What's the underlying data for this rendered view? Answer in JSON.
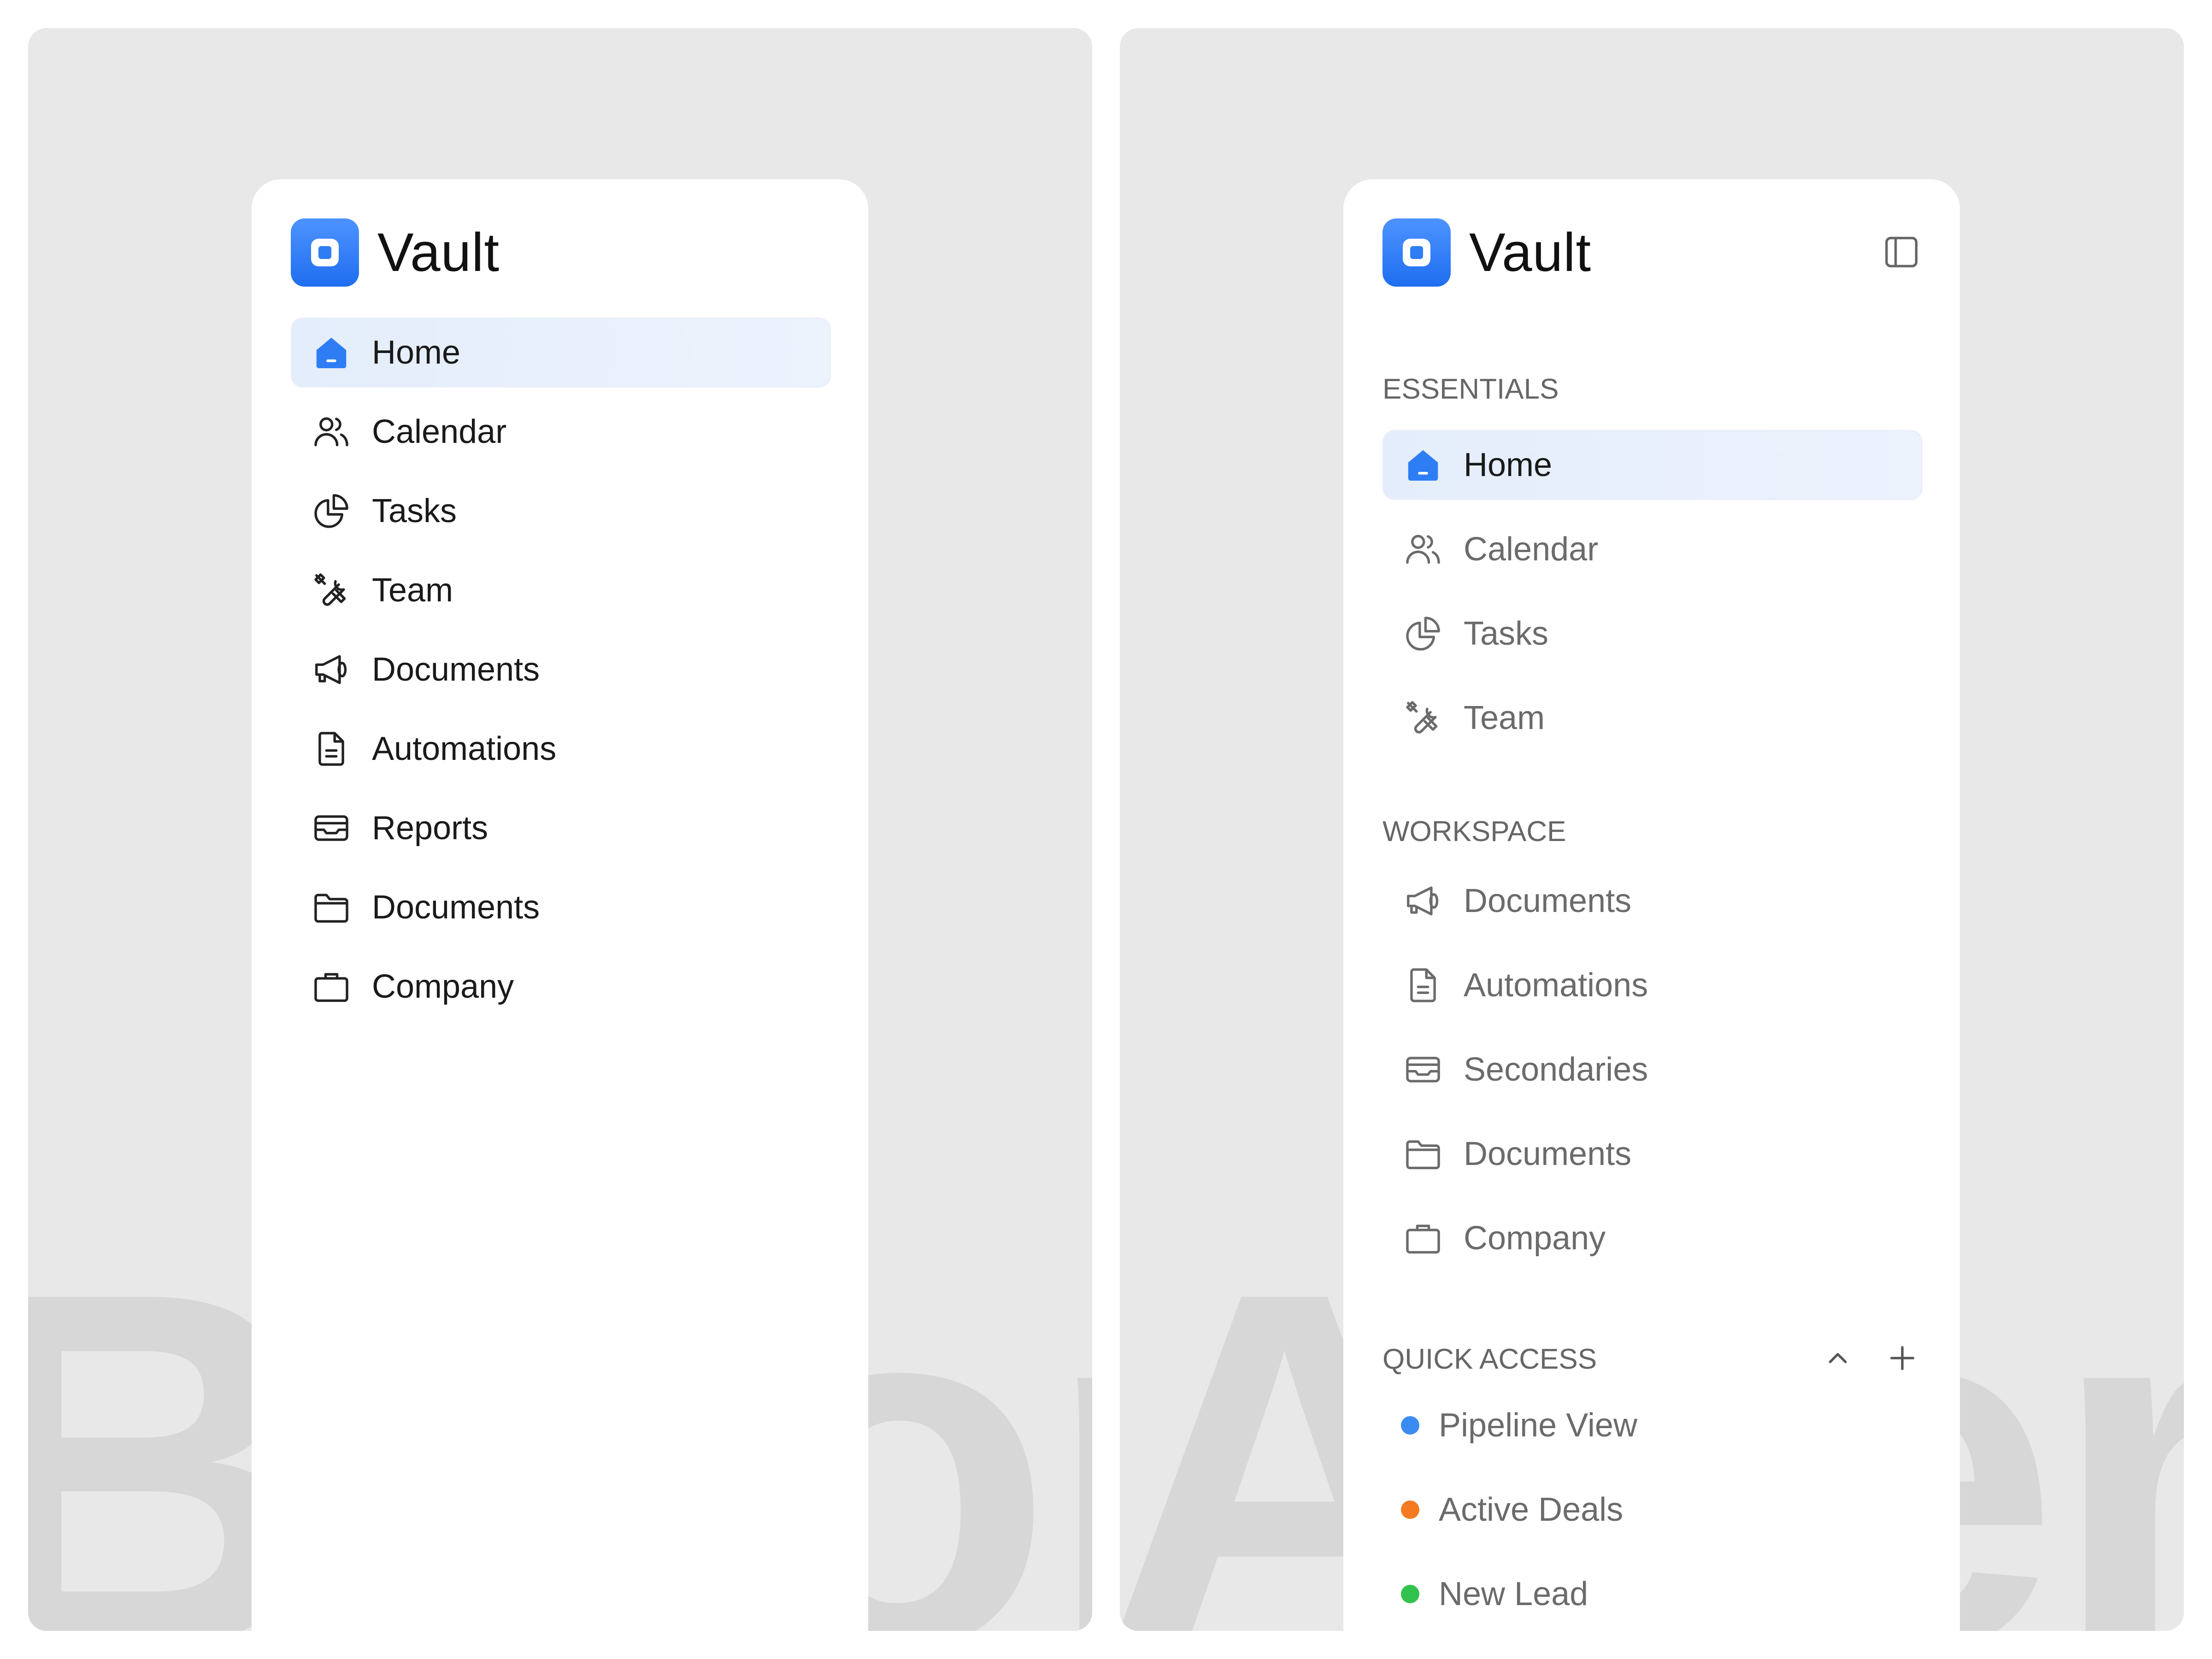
{
  "background_words": {
    "left": "Before",
    "right": "After"
  },
  "left_sidebar": {
    "brand": "Vault",
    "items": [
      {
        "label": "Home",
        "icon": "home-icon",
        "active": true
      },
      {
        "label": "Calendar",
        "icon": "users-icon"
      },
      {
        "label": "Tasks",
        "icon": "pie-chart-icon"
      },
      {
        "label": "Team",
        "icon": "tools-icon"
      },
      {
        "label": "Documents",
        "icon": "megaphone-icon"
      },
      {
        "label": "Automations",
        "icon": "document-icon"
      },
      {
        "label": "Reports",
        "icon": "inbox-icon"
      },
      {
        "label": "Documents",
        "icon": "folder-icon"
      },
      {
        "label": "Company",
        "icon": "briefcase-icon"
      }
    ]
  },
  "right_sidebar": {
    "brand": "Vault",
    "collapse_icon": "sidebar-toggle-icon",
    "essentials": {
      "label": "ESSENTIALS",
      "items": [
        {
          "label": "Home",
          "icon": "home-icon",
          "active": true
        },
        {
          "label": "Calendar",
          "icon": "users-icon"
        },
        {
          "label": "Tasks",
          "icon": "pie-chart-icon"
        },
        {
          "label": "Team",
          "icon": "tools-icon"
        }
      ]
    },
    "workspace": {
      "label": "WORKSPACE",
      "items": [
        {
          "label": "Documents",
          "icon": "megaphone-icon"
        },
        {
          "label": "Automations",
          "icon": "document-icon"
        },
        {
          "label": "Secondaries",
          "icon": "inbox-icon"
        },
        {
          "label": "Documents",
          "icon": "folder-icon"
        },
        {
          "label": "Company",
          "icon": "briefcase-icon"
        }
      ]
    },
    "quick_access": {
      "label": "QUICK ACCESS",
      "controls": [
        "chevron-up-icon",
        "plus-icon"
      ],
      "items": [
        {
          "label": "Pipeline View",
          "color": "#3b8cf0"
        },
        {
          "label": "Active Deals",
          "color": "#f47a22"
        },
        {
          "label": "New Lead",
          "color": "#33c24d"
        }
      ]
    }
  },
  "colors": {
    "accent": "#2f7df5",
    "active_bg": "#e8f0fc"
  }
}
